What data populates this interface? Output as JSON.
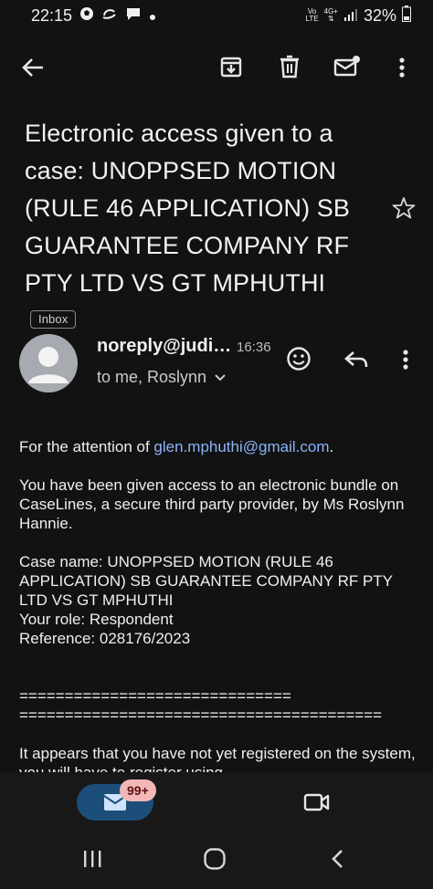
{
  "status_bar": {
    "time": "22:15",
    "network_top": "Vo",
    "network_bottom": "LTE",
    "network_gen": "4G+",
    "battery": "32%"
  },
  "email": {
    "subject": "Electronic access given to a case: UNOPPSED MOTION (RULE 46 APPLICATION) SB GUARANTEE COMPANY RF PTY LTD VS GT MPHUTHI",
    "label": "Inbox",
    "sender": "noreply@judi…",
    "time": "16:36",
    "recipients": "to me, Roslynn",
    "body": {
      "attention_prefix": "For the attention of ",
      "attention_email": "glen.mphuthi@gmail.com",
      "attention_suffix": ".",
      "paragraph1": "You have been given access to an electronic bundle on CaseLines, a secure third party provider, by Ms Roslynn Hannie.",
      "case_name": "Case name: UNOPPSED MOTION (RULE 46 APPLICATION) SB GUARANTEE COMPANY RF PTY LTD VS GT MPHUTHI",
      "role": "Your role: Respondent",
      "reference": "Reference: 028176/2023",
      "separator1": "==============================",
      "separator2": "========================================",
      "paragraph2": "It appears that you have not yet registered on the system, you will have to register using"
    }
  },
  "bottom_nav": {
    "mail_badge": "99+"
  }
}
